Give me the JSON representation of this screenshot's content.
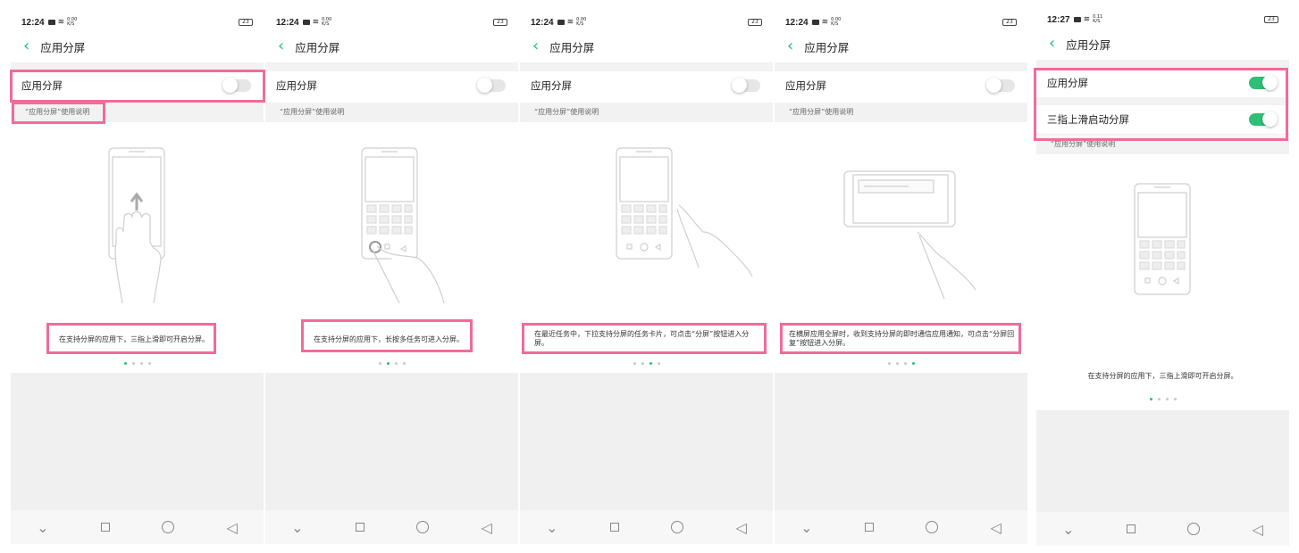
{
  "status_time_1": "12:24",
  "status_time_5": "12:27",
  "net_speed_1": "0.00",
  "net_speed_5": "0.11",
  "net_unit": "K/S",
  "battery": "23",
  "page_title": "应用分屏",
  "switch_label": "应用分屏",
  "three_finger_label": "三指上滑启动分屏",
  "usage_note": "“应用分屏”使用说明",
  "captions": [
    "在支持分屏的应用下，三指上滑即可开启分屏。",
    "在支持分屏的应用下，长按多任务可进入分屏。",
    "在最近任务中，下拉支持分屏的任务卡片，可点击“分屏”按钮进入分屏。",
    "在横屏应用全屏时，收到支持分屏的即时通信应用通知，可点击“分屏回复”按钮进入分屏。",
    "在支持分屏的应用下，三指上滑即可开启分屏。"
  ],
  "active_dot": [
    0,
    1,
    2,
    3,
    0
  ],
  "toggles": {
    "screen1": false,
    "screen2": false,
    "screen3": false,
    "screen4": false,
    "screen5_split": true,
    "screen5_three_finger": true
  },
  "colors": {
    "accent": "#2fbf75",
    "highlight": "#f26b9a",
    "back_arrow": "#1dbf74"
  },
  "icons": [
    "back-icon",
    "wifi-icon",
    "camera-icon",
    "battery-icon",
    "nav-down-icon",
    "nav-square-icon",
    "nav-circle-icon",
    "nav-triangle-icon"
  ]
}
